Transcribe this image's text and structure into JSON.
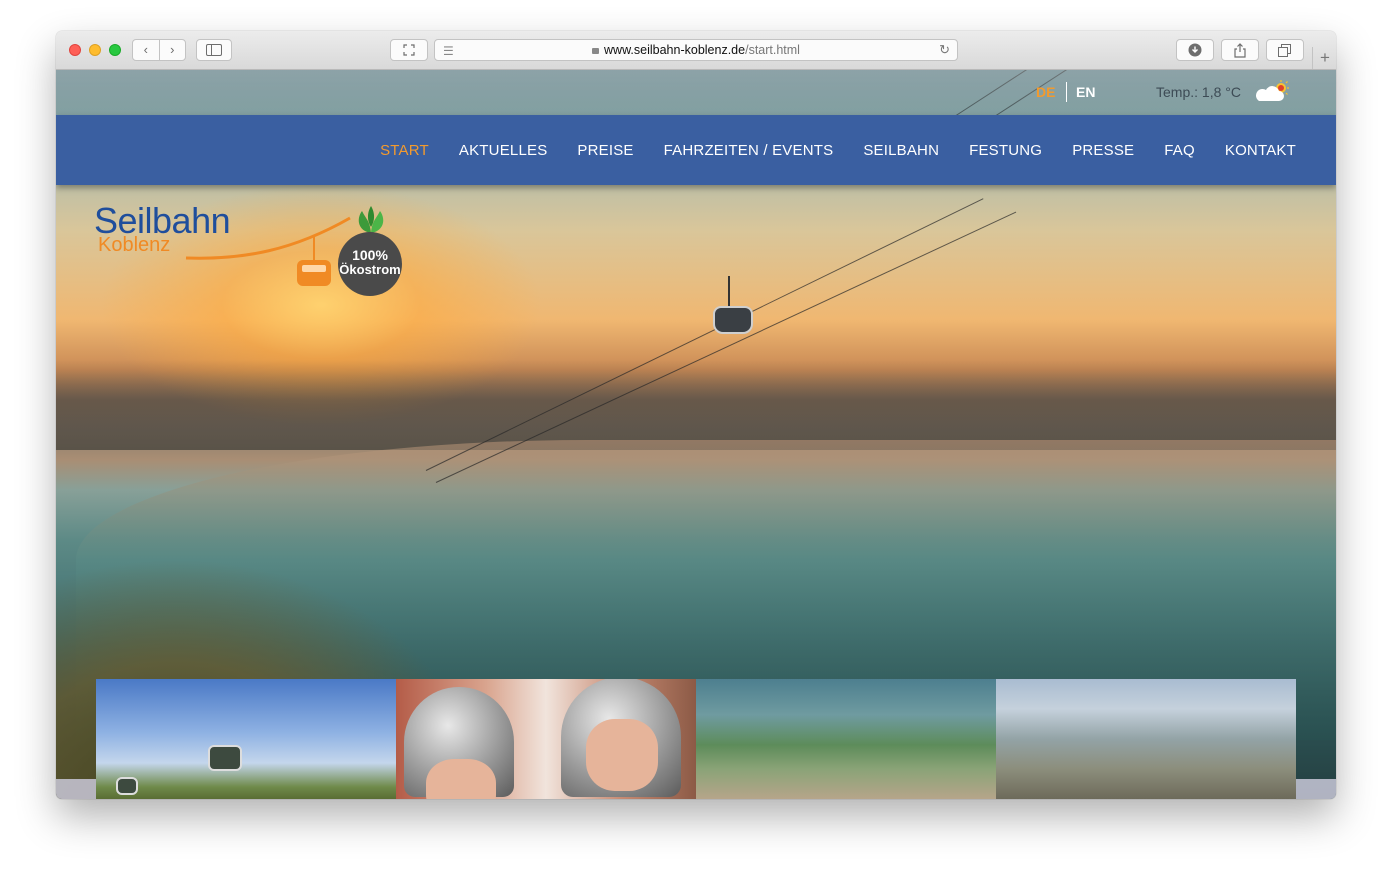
{
  "browser": {
    "url_host": "www.seilbahn-koblenz.de",
    "url_path": "/start.html",
    "icons": [
      "back-icon",
      "forward-icon",
      "sidebar-icon",
      "fullscreen-icon",
      "reader-icon",
      "lock-icon",
      "reload-icon",
      "download-icon",
      "share-icon",
      "tabs-icon",
      "new-tab-icon"
    ]
  },
  "topbar": {
    "lang_de": "DE",
    "lang_en": "EN",
    "temperature": "Temp.: 1,8 °C",
    "weather_icon": "partly-cloudy-icon"
  },
  "nav": {
    "items": [
      {
        "label": "START",
        "active": true
      },
      {
        "label": "AKTUELLES",
        "active": false
      },
      {
        "label": "PREISE",
        "active": false
      },
      {
        "label": "FAHRZEITEN / EVENTS",
        "active": false
      },
      {
        "label": "SEILBAHN",
        "active": false
      },
      {
        "label": "FESTUNG",
        "active": false
      },
      {
        "label": "PRESSE",
        "active": false
      },
      {
        "label": "FAQ",
        "active": false
      },
      {
        "label": "KONTAKT",
        "active": false
      }
    ]
  },
  "logo": {
    "line1": "Seilbahn",
    "line2": "Koblenz"
  },
  "badge": {
    "line1": "100%",
    "line2": "Ökostrom"
  },
  "colors": {
    "nav_bg": "#3a5fa1",
    "accent": "#f29a2e",
    "logo_blue": "#1f4e9c"
  }
}
